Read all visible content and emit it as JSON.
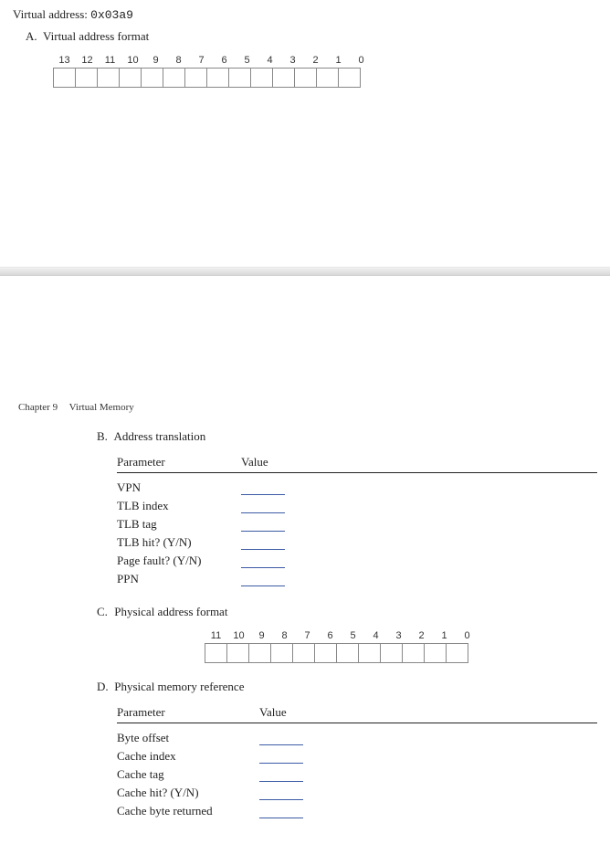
{
  "intro": {
    "virtual_address_label": "Virtual address:",
    "virtual_address_value": "0x03a9"
  },
  "sectionA": {
    "letter": "A.",
    "title": "Virtual address format",
    "bits": [
      "13",
      "12",
      "11",
      "10",
      "9",
      "8",
      "7",
      "6",
      "5",
      "4",
      "3",
      "2",
      "1",
      "0"
    ]
  },
  "chapter": {
    "number": "Chapter 9",
    "title": "Virtual Memory"
  },
  "sectionB": {
    "letter": "B.",
    "title": "Address translation",
    "header_param": "Parameter",
    "header_value": "Value",
    "rows": [
      "VPN",
      "TLB index",
      "TLB tag",
      "TLB hit? (Y/N)",
      "Page fault? (Y/N)",
      "PPN"
    ]
  },
  "sectionC": {
    "letter": "C.",
    "title": "Physical address format",
    "bits": [
      "11",
      "10",
      "9",
      "8",
      "7",
      "6",
      "5",
      "4",
      "3",
      "2",
      "1",
      "0"
    ]
  },
  "sectionD": {
    "letter": "D.",
    "title": "Physical memory reference",
    "header_param": "Parameter",
    "header_value": "Value",
    "rows": [
      "Byte offset",
      "Cache index",
      "Cache tag",
      "Cache hit? (Y/N)",
      "Cache byte returned"
    ]
  }
}
